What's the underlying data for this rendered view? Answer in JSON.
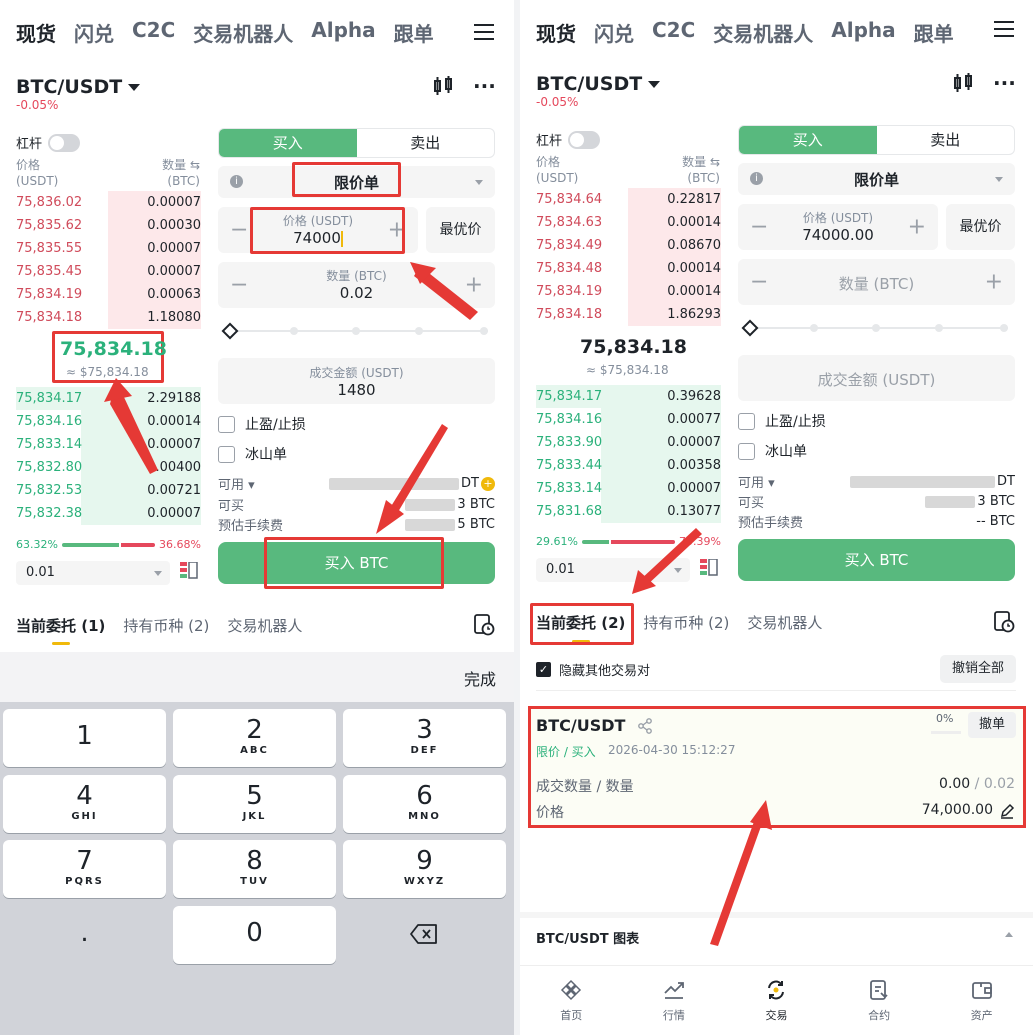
{
  "top_tabs": [
    "现货",
    "闪兑",
    "C2C",
    "交易机器人",
    "Alpha",
    "跟单"
  ],
  "pair": "BTC/USDT",
  "change": "-0.05%",
  "leverage_label": "杠杆",
  "book_header": {
    "price": "价格",
    "price_unit": "(USDT)",
    "qty": "数量",
    "qty_unit": "(BTC)",
    "qty_icon": "⇆"
  },
  "left": {
    "asks": [
      {
        "p": "75,836.02",
        "q": "0.00007"
      },
      {
        "p": "75,835.62",
        "q": "0.00030"
      },
      {
        "p": "75,835.55",
        "q": "0.00007"
      },
      {
        "p": "75,835.45",
        "q": "0.00007"
      },
      {
        "p": "75,834.19",
        "q": "0.00063"
      },
      {
        "p": "75,834.18",
        "q": "1.18080"
      }
    ],
    "mid_price": "75,834.18",
    "mid_usd": "≈ $75,834.18",
    "bids": [
      {
        "p": "75,834.17",
        "q": "2.29188"
      },
      {
        "p": "75,834.16",
        "q": "0.00014"
      },
      {
        "p": "75,833.14",
        "q": "0.00007"
      },
      {
        "p": "75,832.80",
        "q": "0.00400"
      },
      {
        "p": "75,832.53",
        "q": "0.00721"
      },
      {
        "p": "75,832.38",
        "q": "0.00007"
      }
    ],
    "buy_ratio": "63.32%",
    "sell_ratio": "36.68%",
    "step": "0.01",
    "buy_tab": "买入",
    "sell_tab": "卖出",
    "order_type": "限价单",
    "price_label": "价格 (USDT)",
    "price_value": "74000",
    "best_price": "最优价",
    "qty_label": "数量 (BTC)",
    "qty_value": "0.02",
    "amount_label": "成交金额 (USDT)",
    "amount_value": "1480",
    "tp_sl": "止盈/止损",
    "iceberg": "冰山单",
    "available": "可用",
    "available_suffix": "DT",
    "can_buy": "可买",
    "can_buy_suffix": "3 BTC",
    "fee": "预估手续费",
    "fee_suffix": "5 BTC",
    "buy_button": "买入 BTC",
    "bottom_tabs": [
      "当前委托 (1)",
      "持有币种 (2)",
      "交易机器人"
    ],
    "done": "完成",
    "keys": [
      {
        "n": "1",
        "l": ""
      },
      {
        "n": "2",
        "l": "ABC"
      },
      {
        "n": "3",
        "l": "DEF"
      },
      {
        "n": "4",
        "l": "GHI"
      },
      {
        "n": "5",
        "l": "JKL"
      },
      {
        "n": "6",
        "l": "MNO"
      },
      {
        "n": "7",
        "l": "PQRS"
      },
      {
        "n": "8",
        "l": "TUV"
      },
      {
        "n": "9",
        "l": "WXYZ"
      },
      {
        "n": ".",
        "l": ""
      },
      {
        "n": "0",
        "l": ""
      }
    ]
  },
  "right": {
    "asks": [
      {
        "p": "75,834.64",
        "q": "0.22817"
      },
      {
        "p": "75,834.63",
        "q": "0.00014"
      },
      {
        "p": "75,834.49",
        "q": "0.08670"
      },
      {
        "p": "75,834.48",
        "q": "0.00014"
      },
      {
        "p": "75,834.19",
        "q": "0.00014"
      },
      {
        "p": "75,834.18",
        "q": "1.86293"
      }
    ],
    "mid_price": "75,834.18",
    "mid_usd": "≈ $75,834.18",
    "bids": [
      {
        "p": "75,834.17",
        "q": "0.39628"
      },
      {
        "p": "75,834.16",
        "q": "0.00077"
      },
      {
        "p": "75,833.90",
        "q": "0.00007"
      },
      {
        "p": "75,833.44",
        "q": "0.00358"
      },
      {
        "p": "75,833.14",
        "q": "0.00007"
      },
      {
        "p": "75,831.68",
        "q": "0.13077"
      }
    ],
    "buy_ratio": "29.61%",
    "sell_ratio": "70.39%",
    "step": "0.01",
    "price_value": "74000.00",
    "qty_placeholder": "数量 (BTC)",
    "amount_placeholder": "成交金额 (USDT)",
    "can_buy_suffix": "3 BTC",
    "fee_suffix": "-- BTC",
    "bottom_tabs": [
      "当前委托 (2)",
      "持有币种 (2)",
      "交易机器人"
    ],
    "hide_others": "隐藏其他交易对",
    "cancel_all": "撤销全部",
    "order": {
      "pair": "BTC/USDT",
      "progress": "0%",
      "cancel": "撤单",
      "meta_type": "限价 / 买入",
      "meta_time": "2026-04-30 15:12:27",
      "filled_label": "成交数量 / 数量",
      "filled_value": "0.00",
      "filled_total": "/ 0.02",
      "price_label": "价格",
      "price_value": "74,000.00"
    },
    "chart_label": "BTC/USDT 图表",
    "nav": [
      "首页",
      "行情",
      "交易",
      "合约",
      "资产"
    ]
  }
}
